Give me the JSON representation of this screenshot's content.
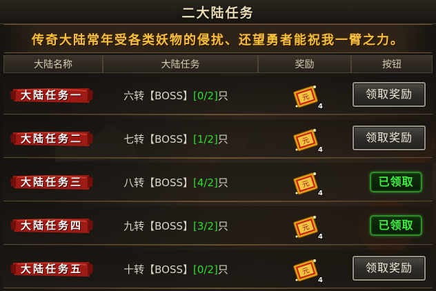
{
  "window": {
    "title": "二大陆任务",
    "close_icon": "close-icon"
  },
  "banner": {
    "text": "传奇大陆常年受各类妖物的侵扰、还望勇者能祝我一臂之力。"
  },
  "columns": {
    "name": "大陆名称",
    "task": "大陆任务",
    "reward": "奖励",
    "button": "按钮"
  },
  "rows": [
    {
      "name": "大陆任务一",
      "task_prefix": "六转【BOSS】",
      "progress": "[0/2]",
      "unit": "只",
      "reward_icon": "scroll-reward-icon",
      "reward_count": "4",
      "button": "领取奖励",
      "state": "claim"
    },
    {
      "name": "大陆任务二",
      "task_prefix": "七转【BOSS】",
      "progress": "[1/2]",
      "unit": "只",
      "reward_icon": "scroll-reward-icon",
      "reward_count": "4",
      "button": "领取奖励",
      "state": "claim"
    },
    {
      "name": "大陆任务三",
      "task_prefix": "八转【BOSS】",
      "progress": "[4/2]",
      "unit": "只",
      "reward_icon": "scroll-reward-icon",
      "reward_count": "4",
      "button": "已领取",
      "state": "done"
    },
    {
      "name": "大陆任务四",
      "task_prefix": "九转【BOSS】",
      "progress": "[3/2]",
      "unit": "只",
      "reward_icon": "scroll-reward-icon",
      "reward_count": "4",
      "button": "已领取",
      "state": "done"
    },
    {
      "name": "大陆任务五",
      "task_prefix": "十转【BOSS】",
      "progress": "[0/2]",
      "unit": "只",
      "reward_icon": "scroll-reward-icon",
      "reward_count": "4",
      "button": "领取奖励",
      "state": "claim"
    }
  ],
  "colors": {
    "progress": "#27e02a",
    "banner": "#f4c040",
    "ribbon": "#9e1a14",
    "done_button": "#40f040"
  }
}
